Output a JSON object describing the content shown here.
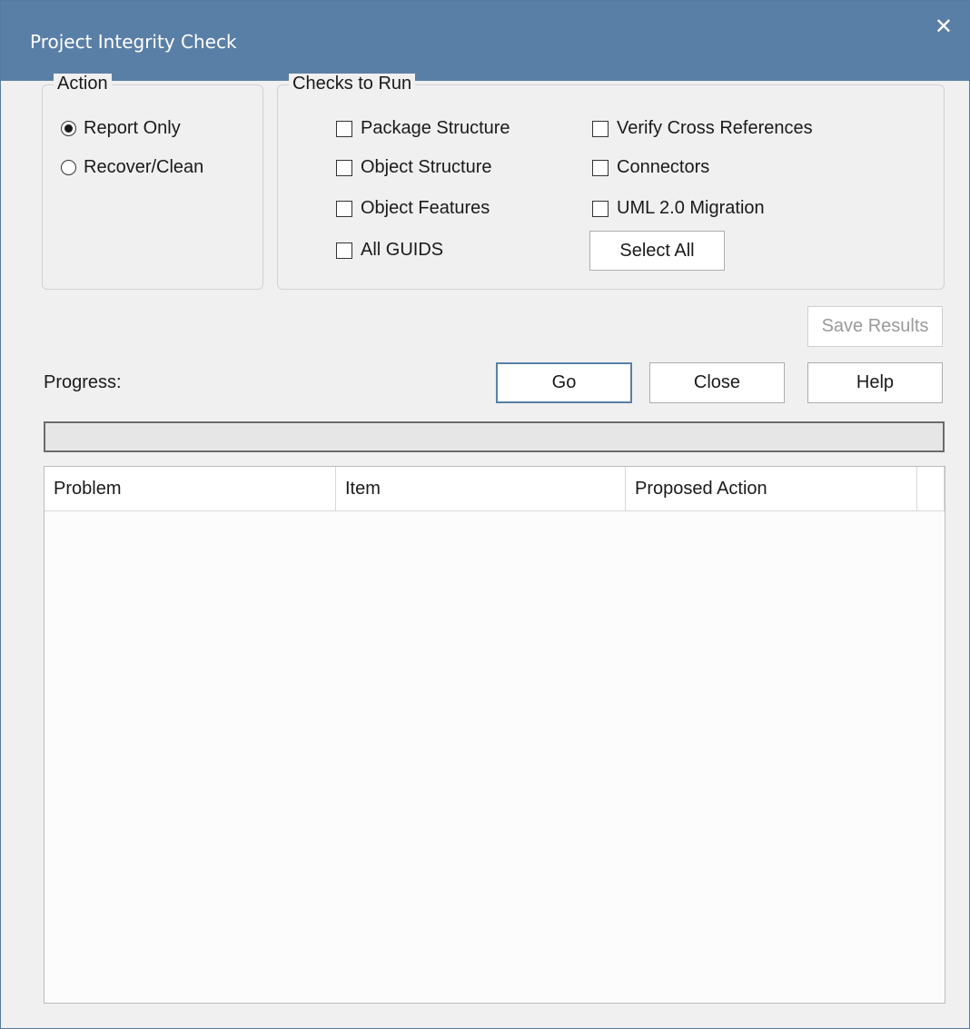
{
  "window": {
    "title": "Project Integrity Check",
    "close_glyph": "✕"
  },
  "action_group": {
    "legend": "Action",
    "options": [
      {
        "label": "Report Only",
        "selected": true
      },
      {
        "label": "Recover/Clean",
        "selected": false
      }
    ]
  },
  "checks_group": {
    "legend": "Checks to Run",
    "items": [
      {
        "label": "Package Structure",
        "checked": false
      },
      {
        "label": "Object Structure",
        "checked": false
      },
      {
        "label": "Object Features",
        "checked": false
      },
      {
        "label": "All GUIDS",
        "checked": false
      },
      {
        "label": "Verify Cross References",
        "checked": false
      },
      {
        "label": "Connectors",
        "checked": false
      },
      {
        "label": "UML 2.0 Migration",
        "checked": false
      }
    ],
    "select_all_label": "Select All"
  },
  "buttons": {
    "save_results": "Save Results",
    "go": "Go",
    "close": "Close",
    "help": "Help"
  },
  "progress": {
    "label": "Progress:",
    "value": 0
  },
  "results_table": {
    "columns": [
      "Problem",
      "Item",
      "Proposed Action"
    ],
    "rows": []
  },
  "colors": {
    "titlebar": "#5a7fa6",
    "default_button_border": "#5a7fa6"
  }
}
